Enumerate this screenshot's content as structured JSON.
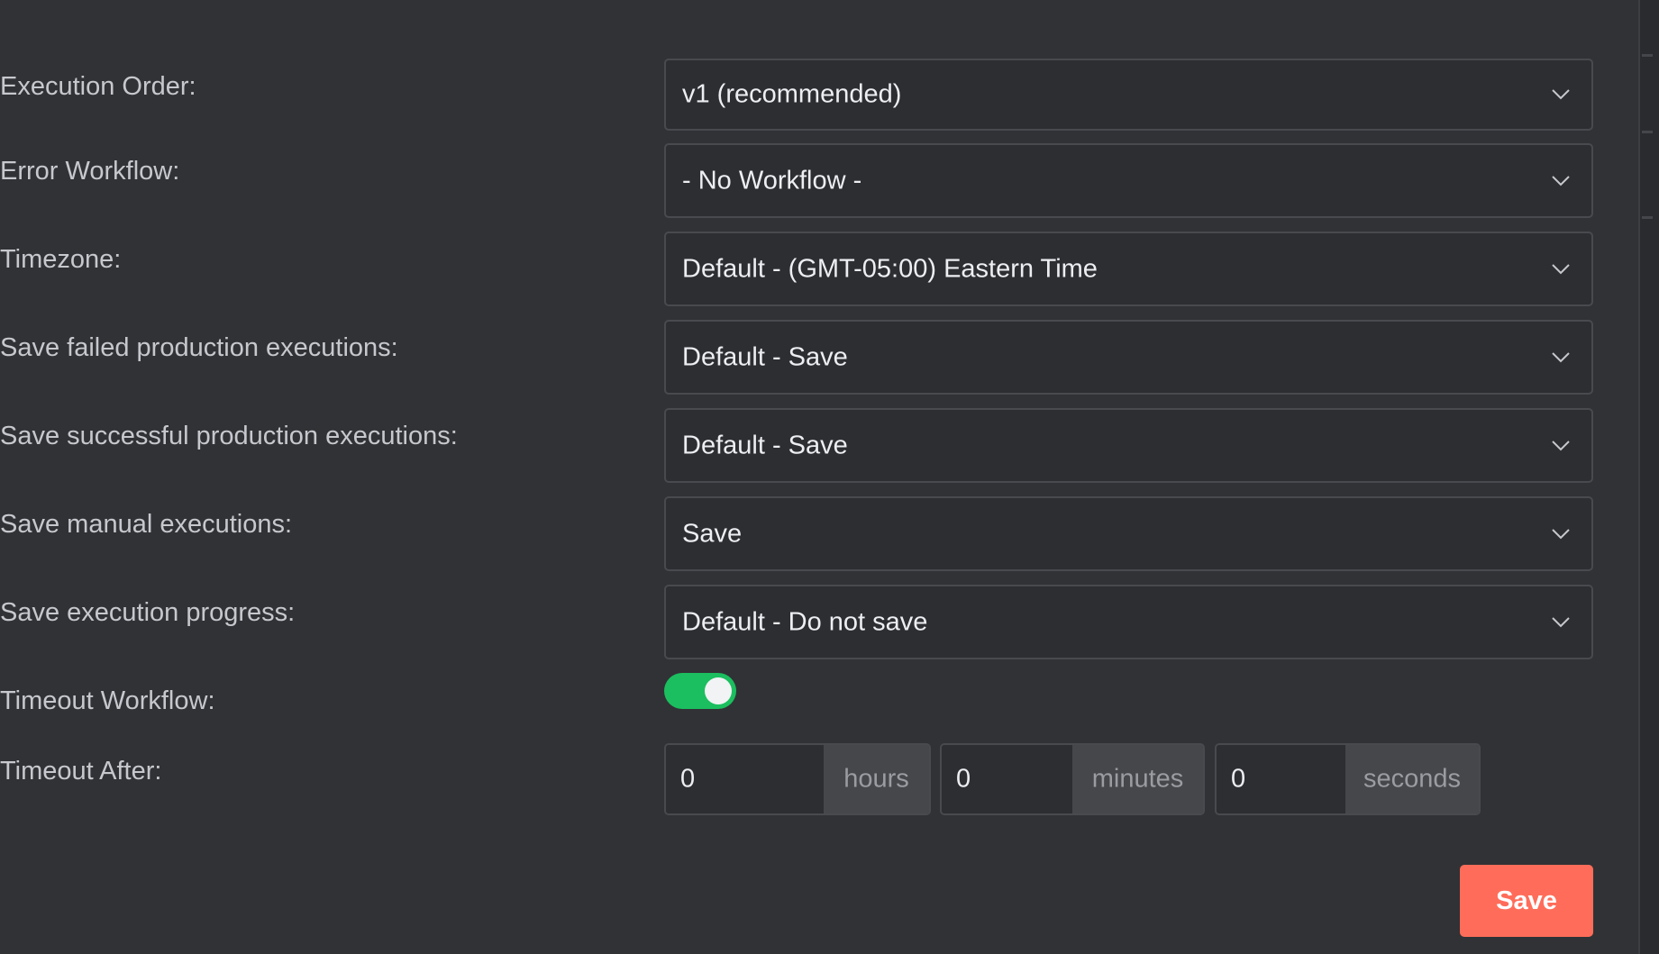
{
  "form": {
    "rows": [
      {
        "label": "Execution Order:",
        "value": "v1 (recommended)"
      },
      {
        "label": "Error Workflow:",
        "value": "- No Workflow -"
      },
      {
        "label": "Timezone:",
        "value": "Default - (GMT-05:00) Eastern Time"
      },
      {
        "label": "Save failed production executions:",
        "value": "Default - Save"
      },
      {
        "label": "Save successful production executions:",
        "value": "Default - Save"
      },
      {
        "label": "Save manual executions:",
        "value": "Save"
      },
      {
        "label": "Save execution progress:",
        "value": "Default - Do not save"
      }
    ],
    "timeout_workflow": {
      "label": "Timeout Workflow:",
      "enabled": true
    },
    "timeout_after": {
      "label": "Timeout After:",
      "hours_value": "0",
      "hours_unit": "hours",
      "minutes_value": "0",
      "minutes_unit": "minutes",
      "seconds_value": "0",
      "seconds_unit": "seconds"
    },
    "save_label": "Save"
  },
  "colors": {
    "background": "#313235",
    "toggle_on": "#1bbf5f",
    "save_button": "#ff6d5a"
  },
  "icons": {
    "dropdown": "chevron-down-icon"
  }
}
